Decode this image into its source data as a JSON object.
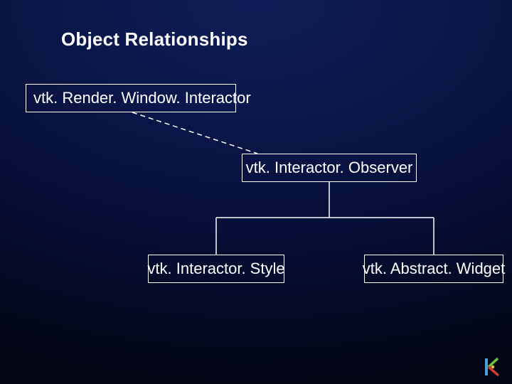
{
  "title": "Object Relationships",
  "nodes": {
    "render_window_interactor": "vtk. Render. Window. Interactor",
    "interactor_observer": "vtk. Interactor. Observer",
    "interactor_style": "vtk. Interactor. Style",
    "abstract_widget": "vtk. Abstract. Widget"
  },
  "edges": [
    {
      "from": "render_window_interactor",
      "to": "interactor_observer",
      "style": "dashed"
    },
    {
      "from": "interactor_observer",
      "to": "interactor_style",
      "style": "solid"
    },
    {
      "from": "interactor_observer",
      "to": "abstract_widget",
      "style": "solid"
    }
  ],
  "logo": {
    "name": "kitware-logo",
    "colors": {
      "blue": "#4aa0d8",
      "green": "#6fbf44",
      "red": "#d33b2f",
      "yellow": "#e8c23b"
    }
  },
  "colors": {
    "bg_top": "#0e1e58",
    "bg_bottom": "#020514",
    "line": "#ffffff",
    "text": "#ffffff"
  }
}
